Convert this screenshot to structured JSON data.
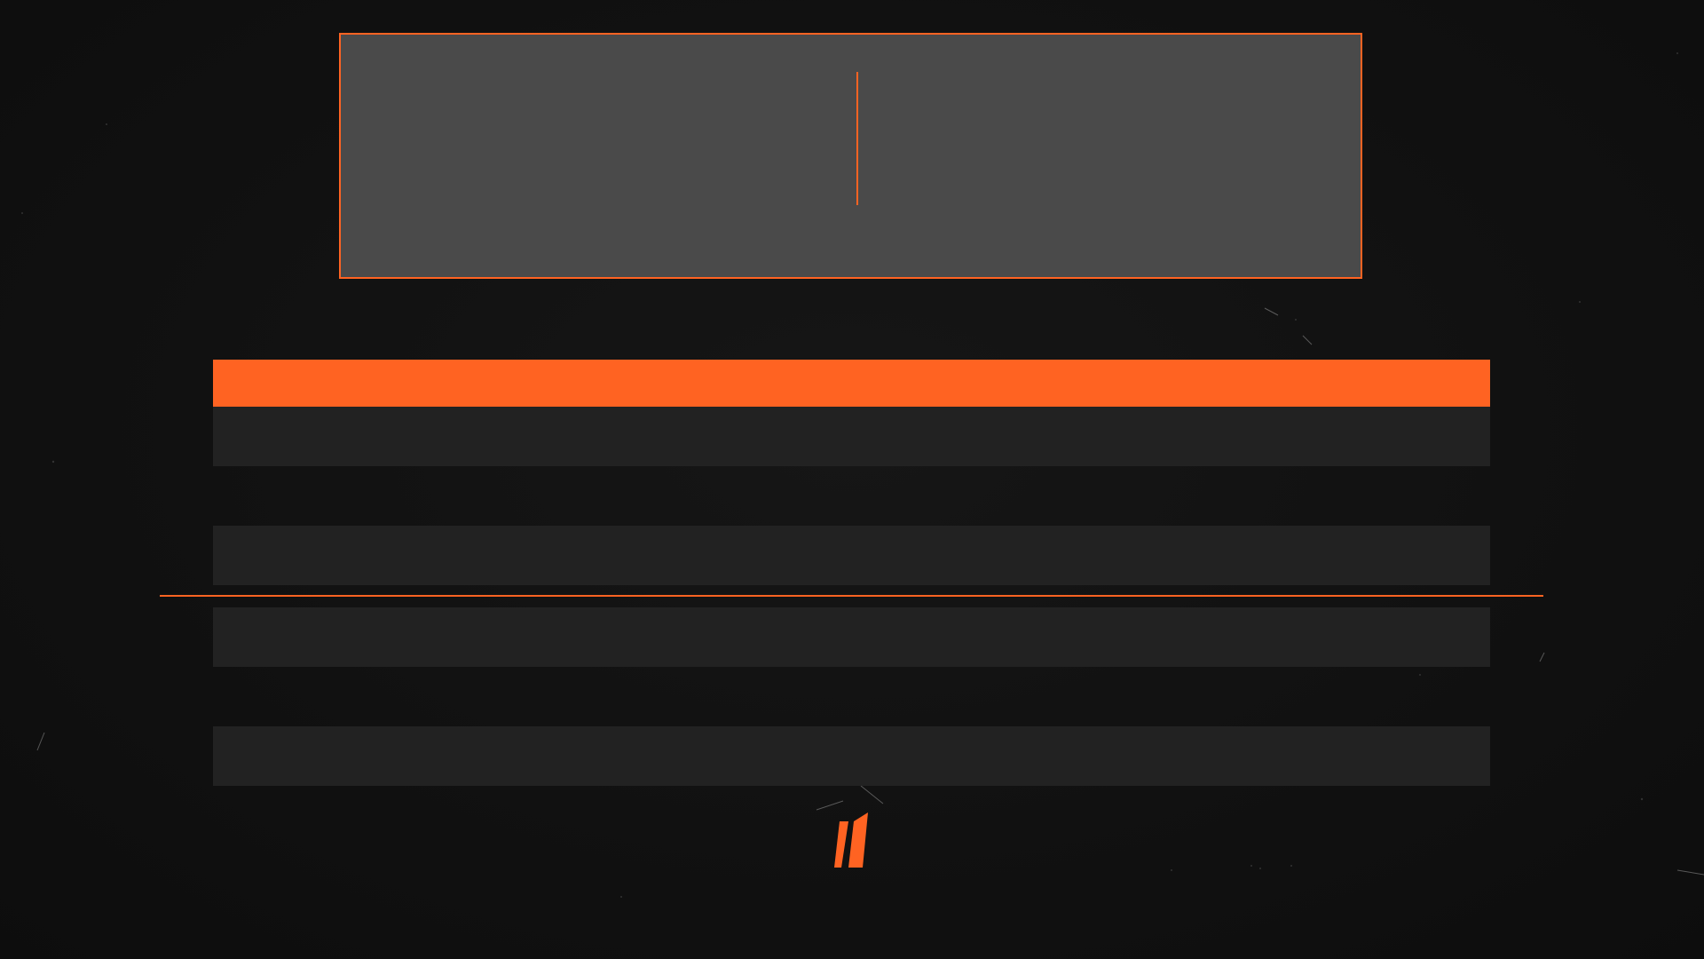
{
  "colors": {
    "background": "#111111",
    "accent": "#ff6322",
    "panel": "#4a4a4a",
    "row": "#222222"
  },
  "hero": {
    "icon": "cursor-divider"
  },
  "list": {
    "header_color": "#ff6322",
    "rows": [
      {
        "label": ""
      },
      {
        "label": ""
      },
      {
        "label": ""
      },
      {
        "label": ""
      }
    ]
  },
  "logo": {
    "icon": "slash-logo-icon"
  }
}
